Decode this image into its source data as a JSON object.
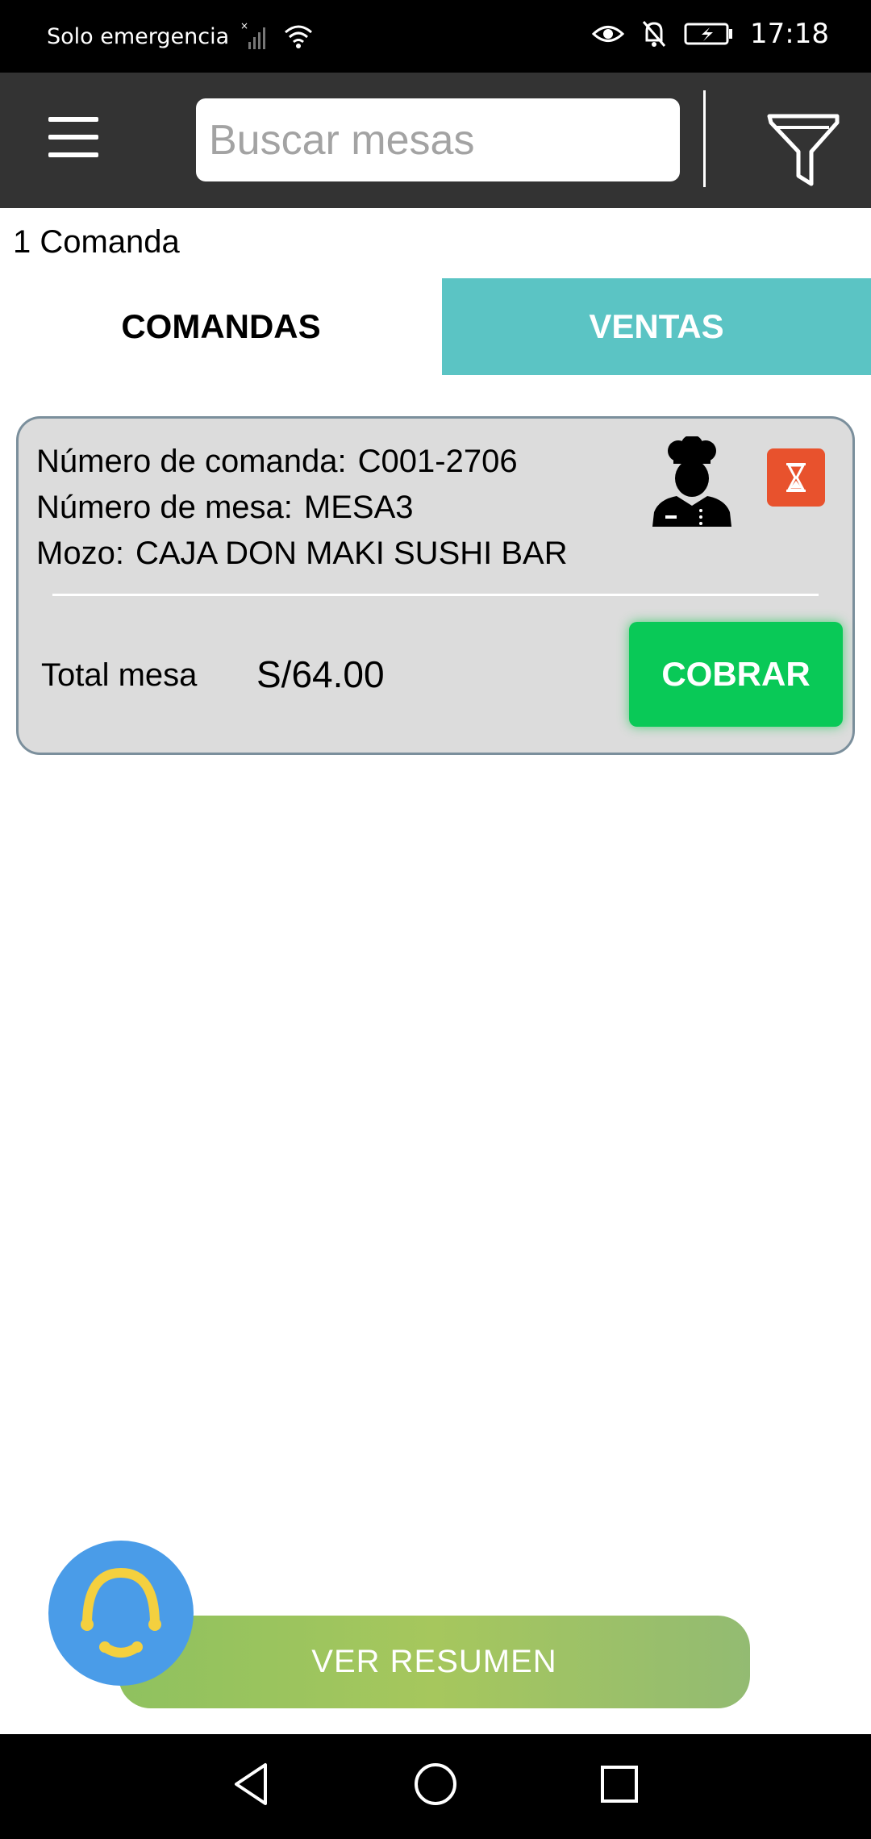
{
  "status_bar": {
    "carrier": "Solo emergencia",
    "time": "17:18",
    "icons": [
      "signal-off-icon",
      "wifi-icon",
      "eye-icon",
      "bell-off-icon",
      "battery-charging-icon"
    ]
  },
  "toolbar": {
    "search_placeholder": "Buscar mesas",
    "menu_icon": "hamburger-menu-icon",
    "filter_icon": "filter-funnel-icon"
  },
  "summary": {
    "count_label": "1 Comanda"
  },
  "tabs": [
    {
      "label": "COMANDAS",
      "active": true
    },
    {
      "label": "VENTAS",
      "active": false
    }
  ],
  "order": {
    "comanda_label": "Número de comanda:",
    "comanda_value": "C001-2706",
    "mesa_label": "Número de mesa:",
    "mesa_value": "MESA3",
    "mozo_label": "Mozo:",
    "mozo_value": "CAJA DON MAKI SUSHI BAR",
    "total_label": "Total mesa",
    "total_value": "S/64.00",
    "charge_label": "COBRAR",
    "status_icon": "hourglass-icon",
    "staff_icon": "chef-icon"
  },
  "footer": {
    "summary_button": "VER RESUMEN",
    "assistant_icon": "assistant-headset-icon"
  },
  "colors": {
    "toolbar": "#333333",
    "tab_inactive": "#5bc4c4",
    "charge_button": "#09c957",
    "status_badge": "#e8522d",
    "summary_button": "#9ac260",
    "assistant": "#4a9ce8"
  }
}
